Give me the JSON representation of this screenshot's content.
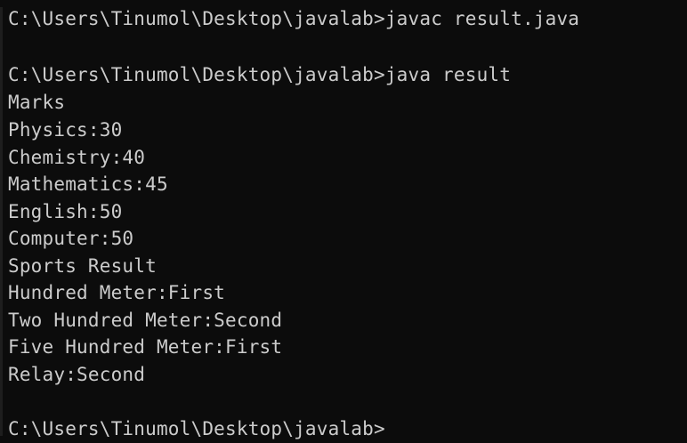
{
  "console": {
    "lines": [
      "C:\\Users\\Tinumol\\Desktop\\javalab>javac result.java",
      "",
      "C:\\Users\\Tinumol\\Desktop\\javalab>java result",
      "Marks",
      "Physics:30",
      "Chemistry:40",
      "Mathematics:45",
      "English:50",
      "Computer:50",
      "Sports Result",
      "Hundred Meter:First",
      "Two Hundred Meter:Second",
      "Five Hundred Meter:First",
      "Relay:Second",
      "",
      "C:\\Users\\Tinumol\\Desktop\\javalab>"
    ]
  },
  "colors": {
    "background": "#0c0c0c",
    "text": "#cccccc"
  }
}
